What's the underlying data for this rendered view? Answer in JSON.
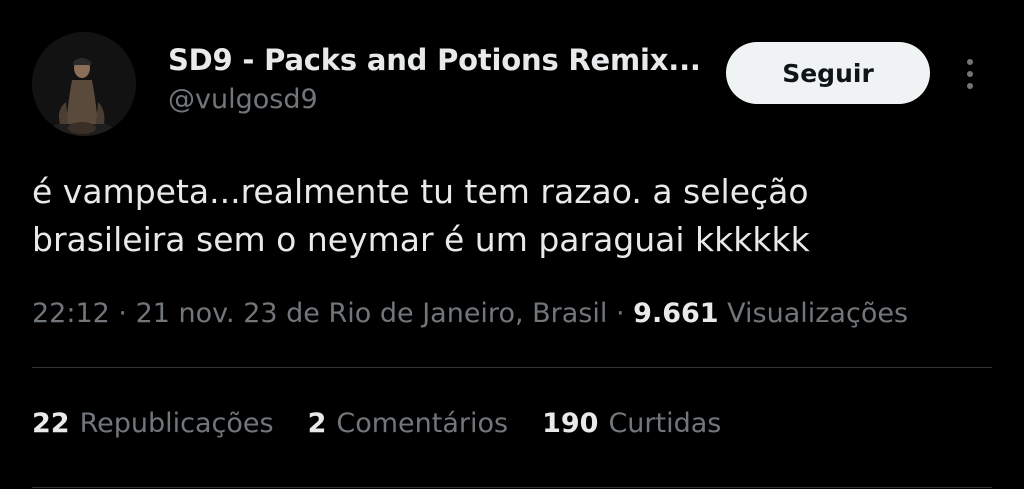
{
  "author": {
    "display_name": "SD9 - Packs and Potions Remix...",
    "handle": "@vulgosd9"
  },
  "follow_button": {
    "label": "Seguir"
  },
  "more_icon": "more-vertical-icon",
  "tweet": {
    "lines": [
      "é vampeta...realmente tu tem razao. a seleção",
      "brasileira sem o neymar é um paraguai kkkkkk"
    ]
  },
  "meta": {
    "time": "22:12",
    "sep1": "·",
    "date": "21 nov. 23",
    "location": "de Rio de Janeiro, Brasil",
    "sep2": "·",
    "views_count": "9.661",
    "views_label": "Visualizações"
  },
  "stats": [
    {
      "count": "22",
      "label": "Republicações"
    },
    {
      "count": "2",
      "label": "Comentários"
    },
    {
      "count": "190",
      "label": "Curtidas"
    }
  ],
  "colors": {
    "background": "#000000",
    "text_primary": "#e7e9ea",
    "text_secondary": "#71767b",
    "button_bg": "#eff3f4",
    "divider": "#2f3336"
  }
}
